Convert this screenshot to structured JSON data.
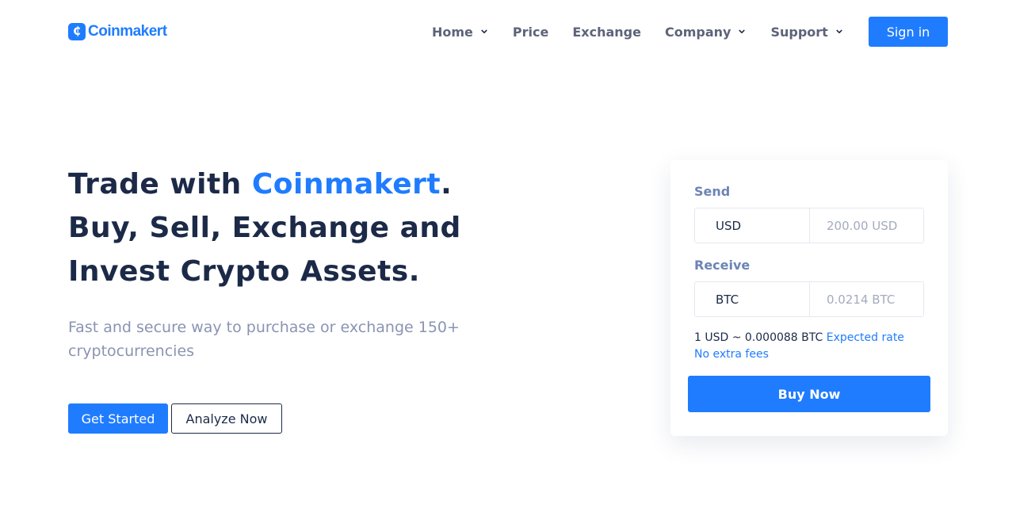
{
  "nav": {
    "logo_text": "Coinmakert",
    "logo_symbol": "₵",
    "items": [
      {
        "label": "Home",
        "has_dropdown": true
      },
      {
        "label": "Price",
        "has_dropdown": false
      },
      {
        "label": "Exchange",
        "has_dropdown": false
      },
      {
        "label": "Company",
        "has_dropdown": true
      },
      {
        "label": "Support",
        "has_dropdown": true
      }
    ],
    "signin_label": "Sign in"
  },
  "hero": {
    "title_prefix": "Trade with ",
    "title_brand": "Coinmakert",
    "title_dot": ".",
    "title_rest": "Buy, Sell, Exchange and Invest Crypto Assets.",
    "subtitle": "Fast and secure way to purchase or exchange 150+ cryptocurrencies",
    "primary_button": "Get Started",
    "secondary_button": "Analyze Now"
  },
  "converter": {
    "send_label": "Send",
    "send_currency": "USD",
    "send_amount": "200.00 USD",
    "receive_label": "Receive",
    "receive_currency": "BTC",
    "receive_amount": "0.0214 BTC",
    "rate_text": "1 USD ~ 0.000088 BTC",
    "rate_note": "Expected rate",
    "fees_note": "No extra fees",
    "buy_button": "Buy Now"
  },
  "colors": {
    "accent": "#1f7cff",
    "heading": "#1c2a48",
    "muted": "#8a94b2"
  }
}
